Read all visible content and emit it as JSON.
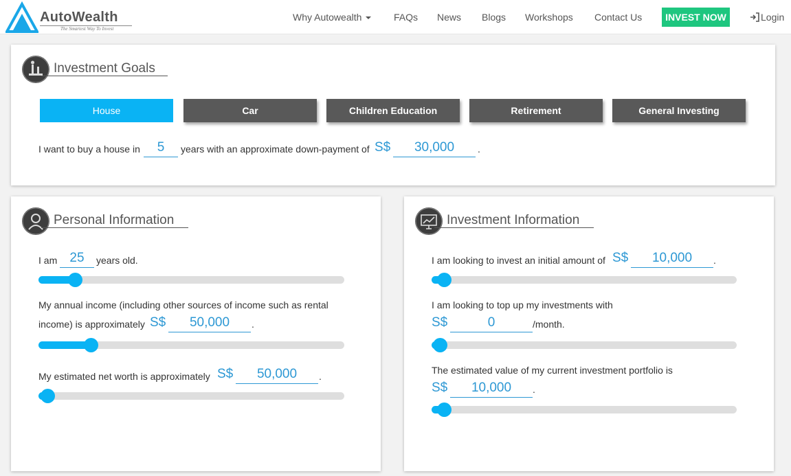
{
  "colors": {
    "accent": "#0ab3f4",
    "invest_btn": "#1ec67f",
    "tab_inactive": "#595959",
    "link_value": "#2d98d4"
  },
  "nav": {
    "brand": "AutoWealth",
    "tagline": "The Smartest Way To Invest",
    "items": [
      "Why Autowealth",
      "FAQs",
      "News",
      "Blogs",
      "Workshops",
      "Contact Us"
    ],
    "invest_now": "INVEST NOW",
    "login": "Login"
  },
  "goals": {
    "title": "Investment Goals",
    "tabs": [
      "House",
      "Car",
      "Children Education",
      "Retirement",
      "General Investing"
    ],
    "active_tab": "House",
    "sentence_1": "I want to buy a house in",
    "years": "5",
    "sentence_2": "years with an approximate down-payment of",
    "currency": "S$",
    "down_payment": "30,000",
    "end": "."
  },
  "personal": {
    "title": "Personal Information",
    "age_prefix": "I am",
    "age": "25",
    "age_suffix": "years old.",
    "age_slider": 0.12,
    "income_line1": "My annual income (including other sources of income such as rental",
    "income_line2": "income) is approximately",
    "income_currency": "S$",
    "income": "50,000",
    "income_end": ".",
    "income_slider": 0.17,
    "networth_label": "My estimated net worth is approximately",
    "networth_currency": "S$",
    "networth": "50,000",
    "networth_end": ".",
    "networth_slider": 0.03
  },
  "investment": {
    "title": "Investment Information",
    "initial_label": "I am looking to invest an initial amount of",
    "initial_currency": "S$",
    "initial": "10,000",
    "initial_end": ".",
    "initial_slider": 0.04,
    "topup_label": "I am looking to top up my investments with",
    "topup_currency": "S$",
    "topup": "0",
    "topup_suffix": "/month.",
    "topup_slider": 0.0,
    "portfolio_label": "The estimated value of my current investment portfolio is",
    "portfolio_currency": "S$",
    "portfolio": "10,000",
    "portfolio_end": ".",
    "portfolio_slider": 0.04
  }
}
